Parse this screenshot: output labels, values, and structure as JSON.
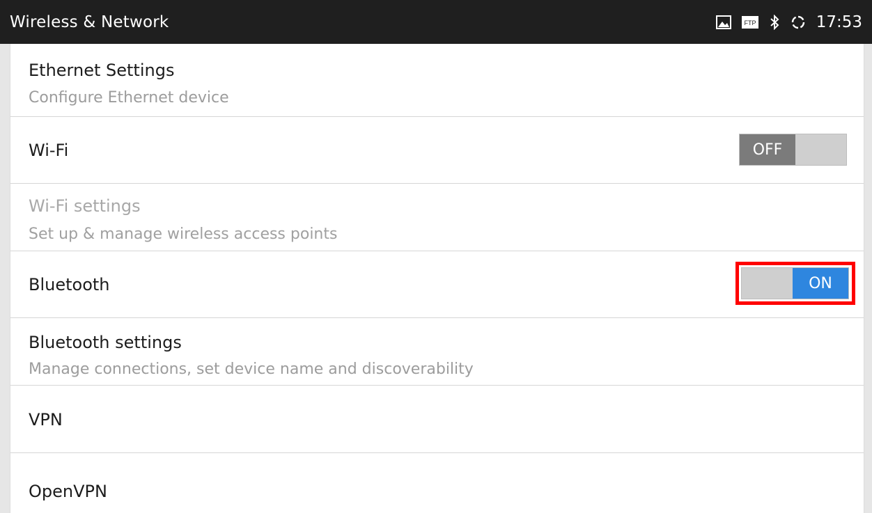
{
  "status_bar": {
    "title": "Wireless & Network",
    "icons": [
      "image-icon",
      "ftp-icon",
      "bluetooth-icon",
      "sync-icon"
    ],
    "ftp_label": "FTP",
    "time": "17:53"
  },
  "settings": [
    {
      "title": "Ethernet Settings",
      "subtitle": "Configure Ethernet device"
    },
    {
      "title": "Wi-Fi",
      "toggle": "OFF"
    },
    {
      "title": "Wi-Fi settings",
      "subtitle": "Set up & manage wireless access points",
      "disabled": true
    },
    {
      "title": "Bluetooth",
      "toggle": "ON"
    },
    {
      "title": "Bluetooth settings",
      "subtitle": "Manage connections, set device name and discoverability"
    },
    {
      "title": "VPN"
    },
    {
      "title": "OpenVPN"
    }
  ],
  "colors": {
    "status_bar_bg": "#1f1f1f",
    "toggle_on": "#2e86df",
    "toggle_off": "#7b7b7b",
    "highlight": "#ff0000"
  }
}
